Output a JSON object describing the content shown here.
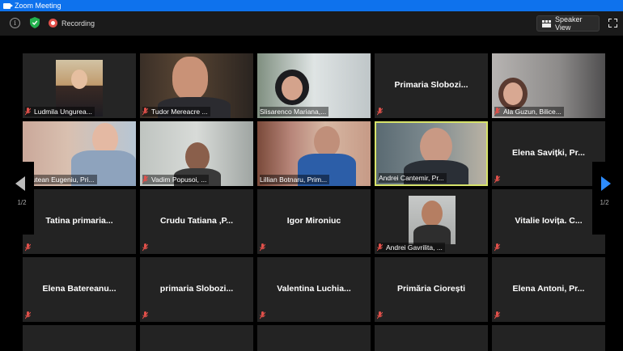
{
  "window": {
    "title": "Zoom Meeting"
  },
  "toolbar": {
    "recording_label": "Recording",
    "speaker_view_label": "Speaker View"
  },
  "pagination": {
    "left": "1/2",
    "right": "1/2"
  },
  "tiles": [
    {
      "name": "Ludmila Ungurea...",
      "video": true,
      "muted": true
    },
    {
      "name": "Tudor Mereacre ...",
      "video": true,
      "muted": true
    },
    {
      "name": "Slisarenco Mariana,...",
      "video": true,
      "muted": false
    },
    {
      "name": "Primaria Slobozi...",
      "video": false,
      "muted": true
    },
    {
      "name": "Ala Guzun, Bilice...",
      "video": true,
      "muted": true
    },
    {
      "name": "Prutean Eugeniu, Pri...",
      "video": true,
      "muted": false
    },
    {
      "name": "Vadim Popusoi, ...",
      "video": true,
      "muted": true
    },
    {
      "name": "Lillian Botnaru, Prim...",
      "video": true,
      "muted": false
    },
    {
      "name": "Andrei Cantemir, Pr...",
      "video": true,
      "muted": false,
      "active": true
    },
    {
      "name": "Elena Savițki, Pr...",
      "video": false,
      "muted": true
    },
    {
      "name": "Tatina primaria...",
      "video": false,
      "muted": true
    },
    {
      "name": "Crudu Tatiana ,P...",
      "video": false,
      "muted": true
    },
    {
      "name": "Igor Mironiuc",
      "video": false,
      "muted": true
    },
    {
      "name": "Andrei Gavrilita, ...",
      "video": true,
      "muted": true
    },
    {
      "name": "Vitalie Iovița. C...",
      "video": false,
      "muted": true
    },
    {
      "name": "Elena Batereanu...",
      "video": false,
      "muted": true
    },
    {
      "name": "primaria Slobozi...",
      "video": false,
      "muted": true
    },
    {
      "name": "Valentina Luchia...",
      "video": false,
      "muted": true
    },
    {
      "name": "Primăria Ciorești",
      "video": false,
      "muted": true
    },
    {
      "name": "Elena Antoni, Pr...",
      "video": false,
      "muted": true
    }
  ],
  "colors": {
    "titlebar": "#0e72ed",
    "active_border": "#d7e36b",
    "muted_mic": "#e0504a",
    "nav_arrow": "#2d8cff"
  },
  "icons": [
    "info-icon",
    "shield-icon",
    "record-icon",
    "grid-icon",
    "fullscreen-icon",
    "muted-mic-icon",
    "arrow-left-icon",
    "arrow-right-icon"
  ]
}
